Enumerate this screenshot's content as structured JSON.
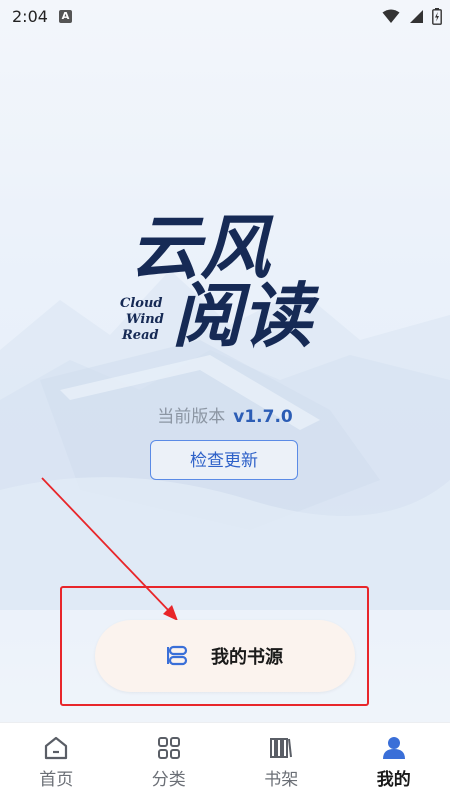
{
  "status": {
    "time": "2:04",
    "notification_letter": "A"
  },
  "app": {
    "title_cn_line1": "云风",
    "title_cn_line2": "阅读",
    "title_en": [
      "Cloud",
      "Wind",
      "Read"
    ]
  },
  "version": {
    "label": "当前版本",
    "number": "v1.7.0"
  },
  "check_update_label": "检查更新",
  "book_source_label": "我的书源",
  "nav": {
    "items": [
      {
        "label": "首页",
        "icon": "home-icon"
      },
      {
        "label": "分类",
        "icon": "grid-icon"
      },
      {
        "label": "书架",
        "icon": "bookshelf-icon"
      },
      {
        "label": "我的",
        "icon": "person-icon"
      }
    ],
    "active_index": 3
  },
  "colors": {
    "accent": "#2e61c8",
    "highlight": "#e8262a",
    "button_bg": "#fbf3ee"
  }
}
